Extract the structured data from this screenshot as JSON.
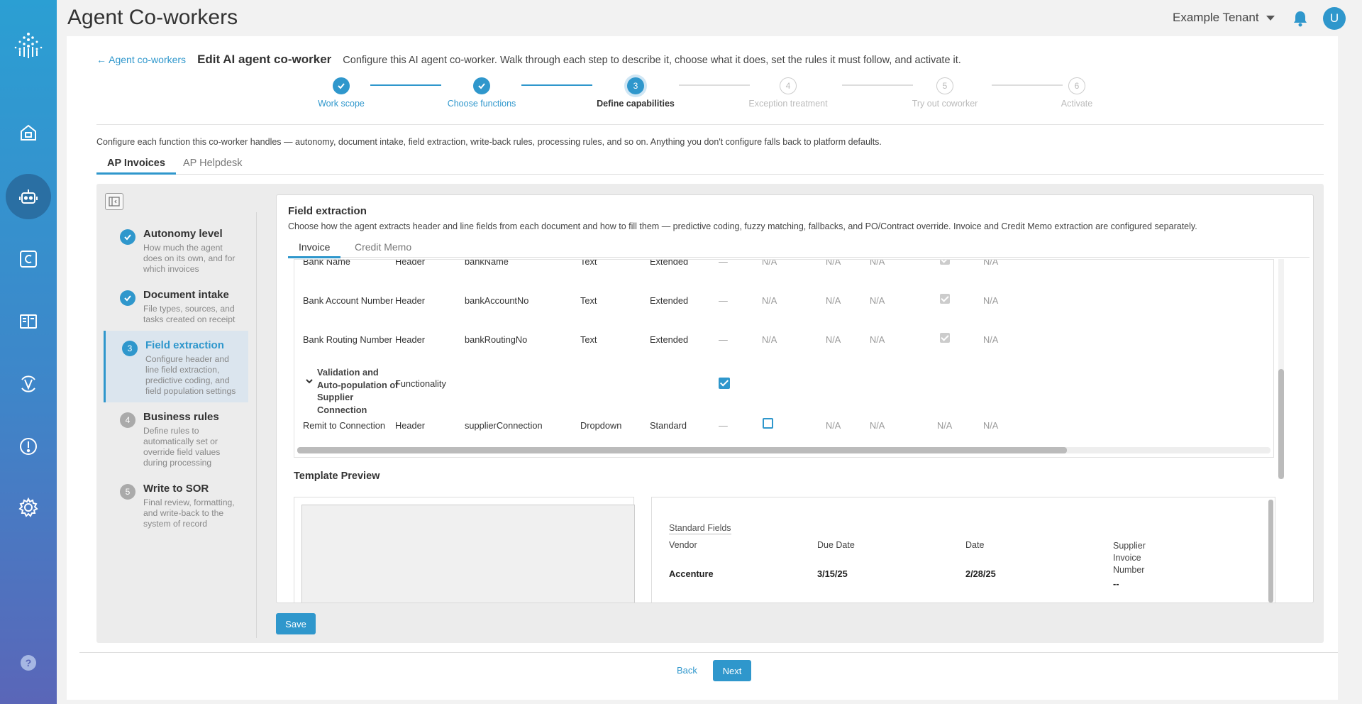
{
  "app": {
    "title": "Agent Co-workers",
    "tenant": "Example Tenant",
    "avatar_initial": "U",
    "accent": "#2f97cc"
  },
  "sidebar": {
    "icons": [
      "logo-icon",
      "home-icon",
      "robot-icon",
      "c-icon",
      "book-icon",
      "v-icon",
      "alert-icon",
      "gear-icon",
      "help-icon"
    ]
  },
  "header": {
    "back_link": "← Agent co-workers",
    "title": "Edit AI agent co-worker",
    "description": "Configure this AI agent co-worker. Walk through each step to describe it, choose what it does, set the rules it must follow, and activate it."
  },
  "stepper": {
    "steps": [
      {
        "label": "Work scope",
        "state": "done",
        "num": "1"
      },
      {
        "label": "Choose functions",
        "state": "done",
        "num": "2"
      },
      {
        "label": "Define capabilities",
        "state": "current",
        "num": "3"
      },
      {
        "label": "Exception treatment",
        "state": "todo",
        "num": "4"
      },
      {
        "label": "Try out coworker",
        "state": "todo",
        "num": "5"
      },
      {
        "label": "Activate",
        "state": "todo",
        "num": "6"
      }
    ]
  },
  "config_desc": "Configure each function this co-worker handles — autonomy, document intake, field extraction, write-back rules, processing rules, and so on. Anything you don't configure falls back to platform defaults.",
  "tabs": [
    "AP Invoices",
    "AP Helpdesk"
  ],
  "left_nav": [
    {
      "title": "Autonomy level",
      "desc": "How much the agent does on its own, and for which invoices",
      "state": "done",
      "num": "1"
    },
    {
      "title": "Document intake",
      "desc": "File types, sources, and tasks created on receipt",
      "state": "done",
      "num": "2"
    },
    {
      "title": "Field extraction",
      "desc": "Configure header and line field extraction, predictive coding, and field population settings",
      "state": "current",
      "num": "3"
    },
    {
      "title": "Business rules",
      "desc": "Define rules to automatically set or override field values during processing",
      "state": "todo",
      "num": "4"
    },
    {
      "title": "Write to SOR",
      "desc": "Final review, formatting, and write-back to the system of record",
      "state": "todo",
      "num": "5"
    }
  ],
  "field_extraction": {
    "title": "Field extraction",
    "desc": "Choose how the agent extracts header and line fields from each document and how to fill them — predictive coding, fuzzy matching, fallbacks, and PO/Contract override. Invoice and Credit Memo extraction are configured separately.",
    "subtabs": [
      "Invoice",
      "Credit Memo"
    ],
    "rows": [
      {
        "name": "Bank Name",
        "level": "Header",
        "key": "bankName",
        "type": "Text",
        "mode": "Extended",
        "dash": "—",
        "na1": "N/A",
        "na2": "N/A",
        "na3": "N/A",
        "na4": "N/A"
      },
      {
        "name": "Bank Account Number",
        "level": "Header",
        "key": "bankAccountNo",
        "type": "Text",
        "mode": "Extended",
        "dash": "—",
        "na1": "N/A",
        "na2": "N/A",
        "na3": "N/A",
        "na4": "N/A"
      },
      {
        "name": "Bank Routing Number",
        "level": "Header",
        "key": "bankRoutingNo",
        "type": "Text",
        "mode": "Extended",
        "dash": "—",
        "na1": "N/A",
        "na2": "N/A",
        "na3": "N/A",
        "na4": "N/A"
      },
      {
        "name": "Validation and Auto-population of Supplier Connection",
        "level": "Functionality"
      },
      {
        "name": "Remit to Connection",
        "level": "Header",
        "key": "supplierConnection",
        "type": "Dropdown",
        "mode": "Standard",
        "dash": "—",
        "na1": "N/A",
        "na2": "N/A",
        "na3": "N/A",
        "na4": "N/A"
      }
    ]
  },
  "template_preview": {
    "title": "Template Preview",
    "section": "Standard Fields",
    "columns": [
      "Vendor",
      "Due Date",
      "Date",
      "Supplier Invoice Number"
    ],
    "values": [
      "Accenture",
      "3/15/25",
      "2/28/25",
      "--"
    ]
  },
  "buttons": {
    "save": "Save",
    "back": "Back",
    "next": "Next"
  }
}
